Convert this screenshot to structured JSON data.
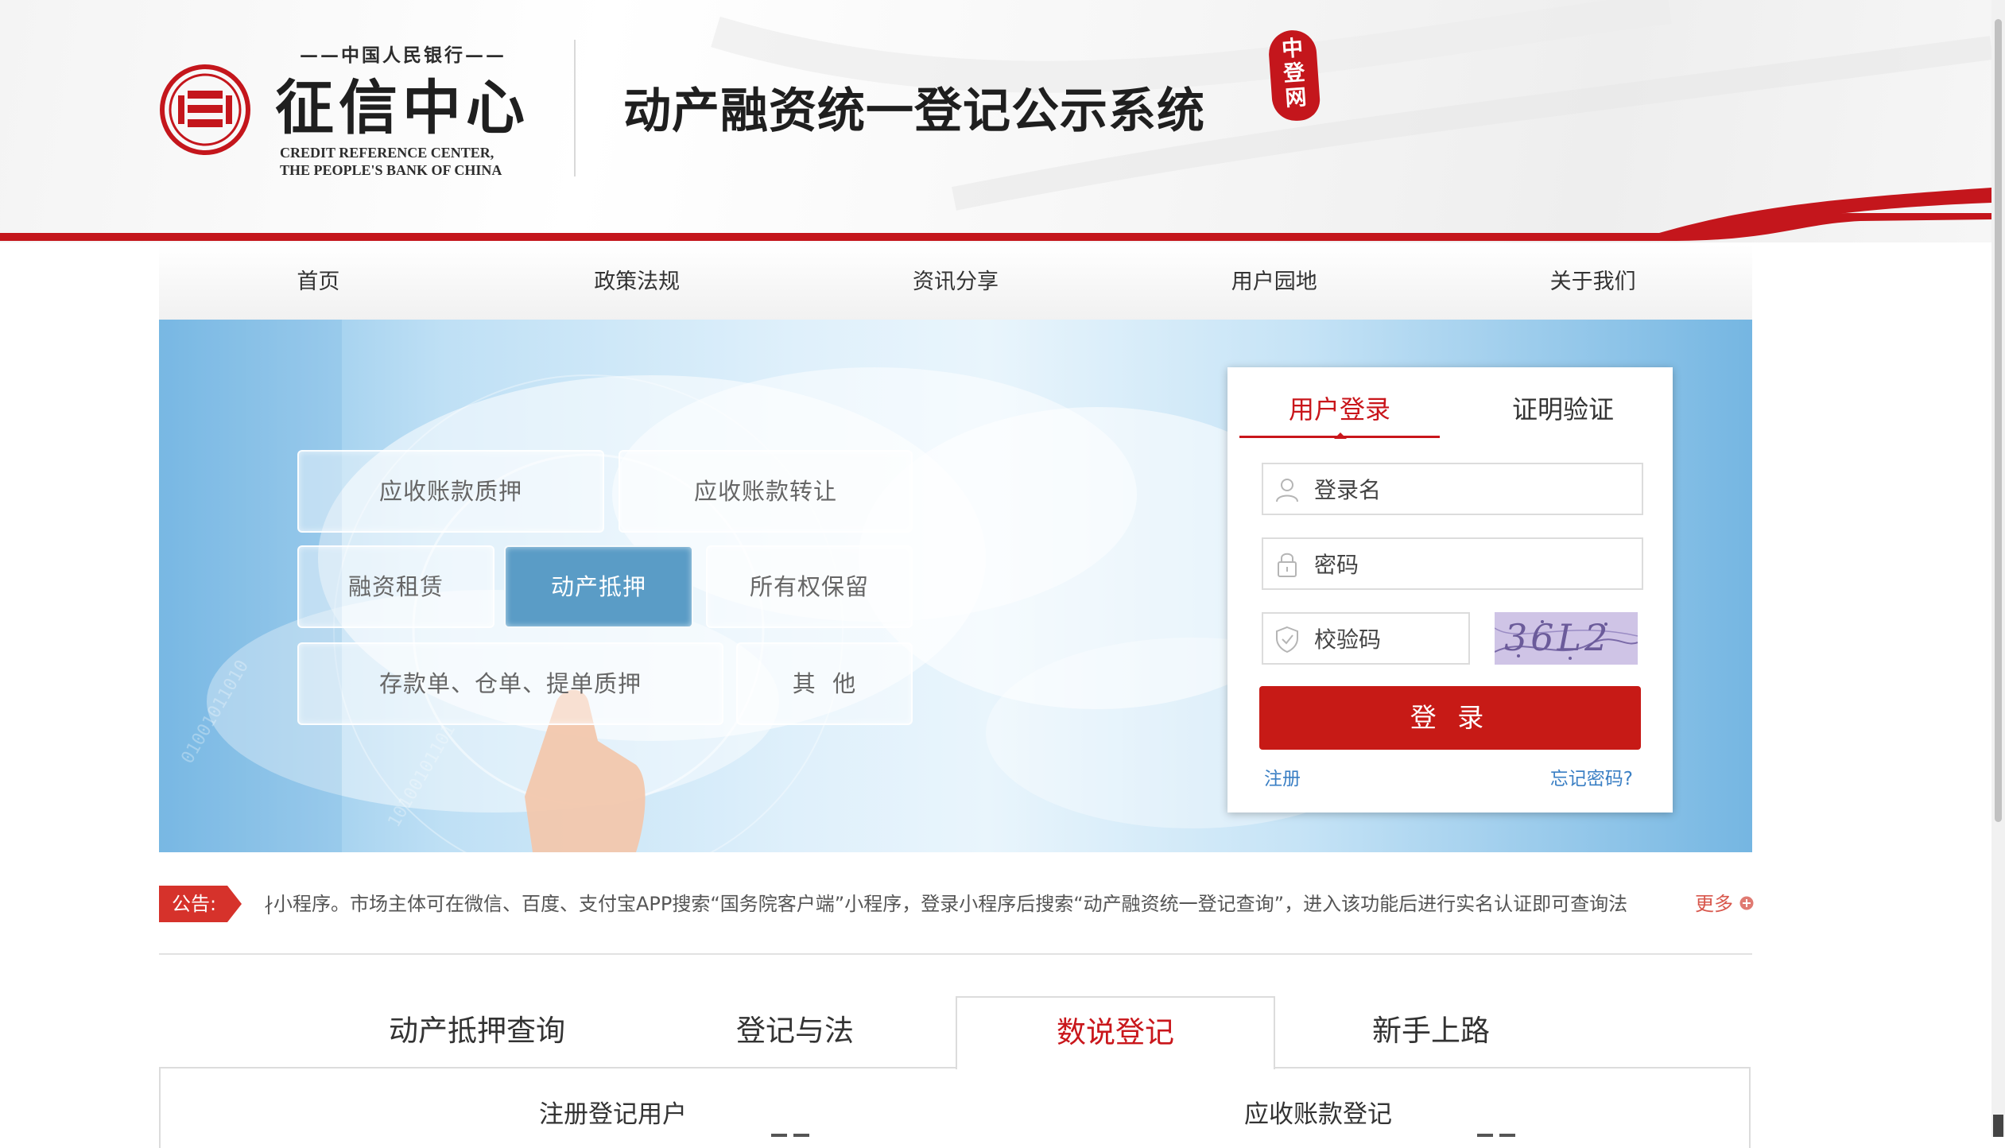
{
  "header": {
    "logo_sub_top": "——中国人民银行——",
    "logo_main": "征信中心",
    "logo_en_line1": "CREDIT REFERENCE CENTER,",
    "logo_en_line2": "THE PEOPLE'S BANK OF CHINA",
    "system_title": "动产融资统一登记公示系统",
    "seal_chars": [
      "中",
      "登",
      "网"
    ],
    "brand_color": "#c4161c"
  },
  "nav": {
    "items": [
      {
        "label": "首页"
      },
      {
        "label": "政策法规"
      },
      {
        "label": "资讯分享"
      },
      {
        "label": "用户园地"
      },
      {
        "label": "关于我们"
      }
    ]
  },
  "banner": {
    "tiles": [
      {
        "label": "应收账款质押"
      },
      {
        "label": "应收账款转让"
      },
      {
        "label": "融资租赁"
      },
      {
        "label": "动产抵押",
        "active": true
      },
      {
        "label": "所有权保留"
      },
      {
        "label": "存款单、仓单、提单质押"
      },
      {
        "label": "其  他"
      }
    ]
  },
  "login": {
    "tab_login": "用户登录",
    "tab_verify": "证明验证",
    "username_placeholder": "登录名",
    "password_placeholder": "密码",
    "captcha_placeholder": "校验码",
    "captcha_text": "36L2",
    "login_button": "登 录",
    "register_link": "注册",
    "forgot_link": "忘记密码?",
    "accent_color": "#c9161b"
  },
  "notice": {
    "badge": "公告:",
    "text": "∤小程序。市场主体可在微信、百度、支付宝APP搜索“国务院客户端”小程序，登录小程序后搜索“动产融资统一登记查询”，进入该功能后进行实名认证即可查询法",
    "more": "更多"
  },
  "bottom_tabs": {
    "items": [
      {
        "label": "动产抵押查询"
      },
      {
        "label": "登记与法"
      },
      {
        "label": "数说登记",
        "active": true
      },
      {
        "label": "新手上路"
      }
    ],
    "stats": {
      "registered_users": "注册登记用户",
      "receivables": "应收账款登记"
    }
  }
}
